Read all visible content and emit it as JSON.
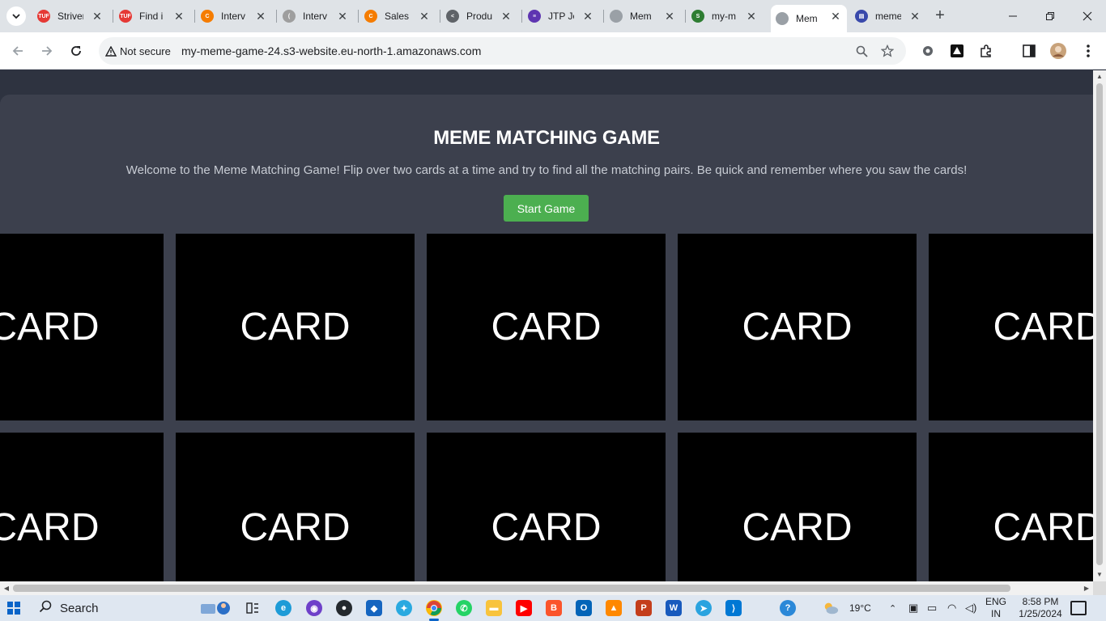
{
  "browser": {
    "tabs": [
      {
        "title": "Striver",
        "fav_color": "#e53935",
        "fav_text": "TUF"
      },
      {
        "title": "Find i",
        "fav_color": "#e53935",
        "fav_text": "TUF"
      },
      {
        "title": "Interv",
        "fav_color": "#f57c00",
        "fav_text": "C"
      },
      {
        "title": "Interv",
        "fav_color": "#9e9e9e",
        "fav_text": "("
      },
      {
        "title": "Sales",
        "fav_color": "#f57c00",
        "fav_text": "C"
      },
      {
        "title": "Produ",
        "fav_color": "#5f6368",
        "fav_text": "<"
      },
      {
        "title": "JTP Jo",
        "fav_color": "#5e35b1",
        "fav_text": "≡"
      },
      {
        "title": "Mem",
        "fav_color": "#9aa0a6",
        "fav_text": ""
      },
      {
        "title": "my-m",
        "fav_color": "#2e7d32",
        "fav_text": "S"
      },
      {
        "title": "Mem",
        "fav_color": "#9aa0a6",
        "fav_text": "",
        "active": true
      },
      {
        "title": "meme",
        "fav_color": "#3949ab",
        "fav_text": "▤"
      }
    ],
    "security_label": "Not secure",
    "url": "my-meme-game-24.s3-website.eu-north-1.amazonaws.com"
  },
  "page": {
    "title": "MEME MATCHING GAME",
    "intro": "Welcome to the Meme Matching Game! Flip over two cards at a time and try to find all the matching pairs. Be quick and remember where you saw the cards!",
    "start_button": "Start Game",
    "card_label": "CARD"
  },
  "taskbar": {
    "search_label": "Search",
    "weather": "19°C",
    "lang_top": "ENG",
    "lang_bottom": "IN",
    "time": "8:58 PM",
    "date": "1/25/2024"
  }
}
